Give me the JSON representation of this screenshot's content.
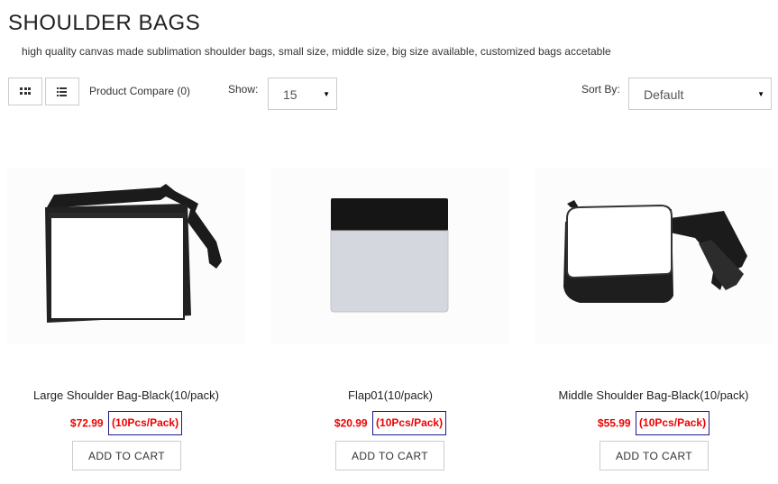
{
  "page": {
    "title": "SHOULDER BAGS",
    "description": "high quality canvas made sublimation shoulder bags, small size, middle size, big size available, customized bags accetable"
  },
  "toolbar": {
    "grid_view_icon": "grid-icon",
    "list_view_icon": "list-icon",
    "compare_label": "Product Compare (0)",
    "show_label": "Show:",
    "show_value": "15",
    "sort_label": "Sort By:",
    "sort_value": "Default"
  },
  "colors": {
    "price": "#ee0000",
    "pack_border": "#1a1a8c"
  },
  "products": [
    {
      "name": "Large Shoulder Bag-Black(10/pack)",
      "price": "$72.99",
      "pack": "(10Pcs/Pack)",
      "button": "ADD TO CART"
    },
    {
      "name": "Flap01(10/pack)",
      "price": "$20.99",
      "pack": "(10Pcs/Pack)",
      "button": "ADD TO CART"
    },
    {
      "name": "Middle Shoulder Bag-Black(10/pack)",
      "price": "$55.99",
      "pack": "(10Pcs/Pack)",
      "button": "ADD TO CART"
    }
  ]
}
